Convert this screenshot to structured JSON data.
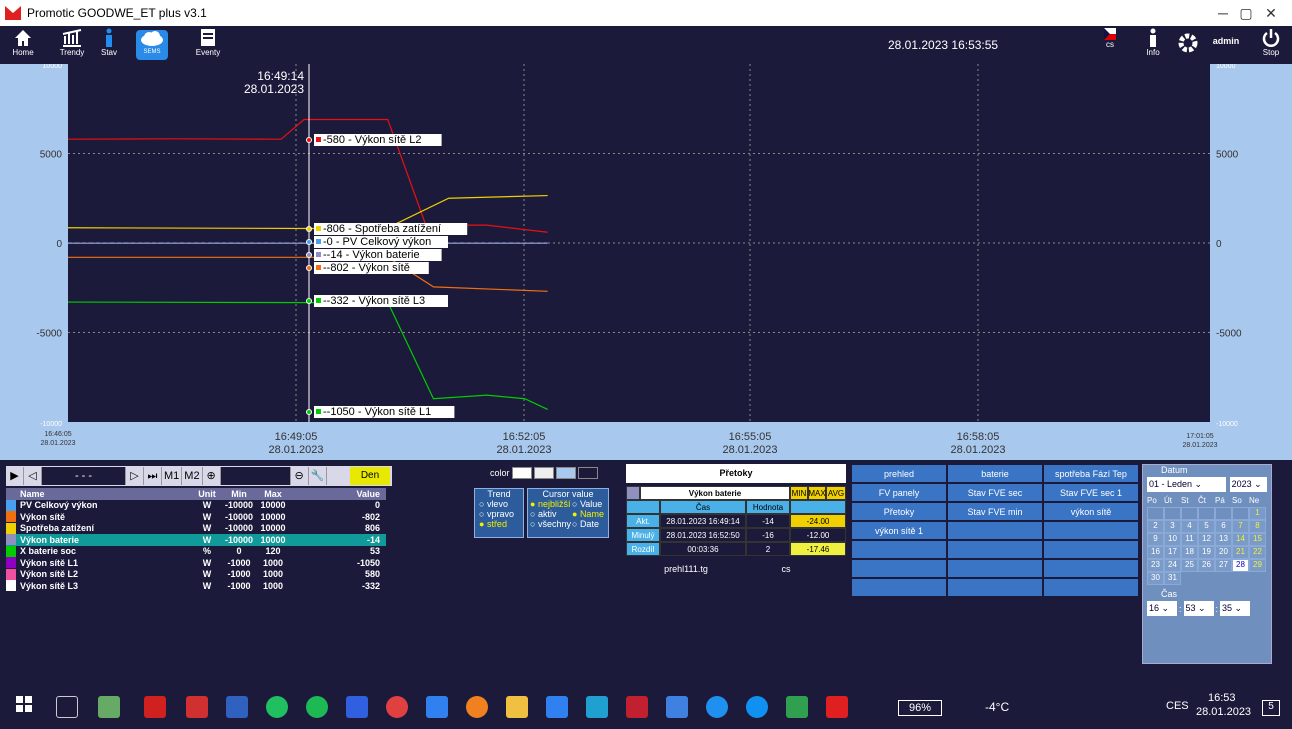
{
  "window": {
    "title": "Promotic GOODWE_ET plus  v3.1"
  },
  "toolbar": {
    "home": "Home",
    "trendy": "Trendy",
    "stav": "Stav",
    "sems": "SEMS",
    "eventy": "Eventy",
    "datetime": "28.01.2023 16:53:55",
    "lang": "cs",
    "info": "Info",
    "user": "admin",
    "stop": "Stop"
  },
  "chart": {
    "cursor_time": "16:49:14",
    "cursor_date": "28.01.2023",
    "left_ticks": [
      "10000",
      "5000",
      "0",
      "-5000",
      "-10000"
    ],
    "right_ticks": [
      "10000",
      "5000",
      "0",
      "-5000",
      "-10000"
    ],
    "x_start_time": "16:46:05",
    "x_start_date": "28.01.2023",
    "x_end_time": "17:01:05",
    "x_end_date": "28.01.2023",
    "x_ticks": [
      {
        "t": "16:49:05",
        "d": "28.01.2023"
      },
      {
        "t": "16:52:05",
        "d": "28.01.2023"
      },
      {
        "t": "16:55:05",
        "d": "28.01.2023"
      },
      {
        "t": "16:58:05",
        "d": "28.01.2023"
      }
    ],
    "labels": [
      "580 - Výkon sítě L2",
      "806 - Spotřeba zatížení",
      "0 - PV Celkový výkon",
      "-14 - Výkon baterie",
      "-802 - Výkon sítě",
      "-332 - Výkon sítě L3",
      "-1050 - Výkon sítě L1"
    ],
    "colors": {
      "L2": "#e81010",
      "spotreba": "#f0d000",
      "pv": "#4aa0f0",
      "baterie": "#9090c0",
      "sit": "#f07010",
      "L3": "#00cc00",
      "L1": "#00cc00"
    }
  },
  "chart_data": {
    "type": "line",
    "x": [
      "16:46:05",
      "16:49:05",
      "16:52:05",
      "16:55:05",
      "16:58:05",
      "17:01:05"
    ],
    "ylim": [
      -10000,
      10000
    ],
    "series": [
      {
        "name": "Výkon sítě L2",
        "values": [
          5800,
          5800,
          1100,
          600,
          null,
          null
        ]
      },
      {
        "name": "Spotřeba zatížení",
        "values": [
          850,
          810,
          2550,
          2650,
          null,
          null
        ]
      },
      {
        "name": "PV Celkový výkon",
        "values": [
          0,
          0,
          0,
          0,
          null,
          null
        ]
      },
      {
        "name": "Výkon baterie",
        "values": [
          -14,
          -14,
          -14,
          -14,
          null,
          null
        ]
      },
      {
        "name": "Výkon sítě",
        "values": [
          -800,
          -800,
          -2450,
          -2700,
          null,
          null
        ]
      },
      {
        "name": "Výkon sítě L3",
        "values": [
          -3300,
          -3330,
          -8700,
          -9300,
          null,
          null
        ]
      }
    ]
  },
  "controls": {
    "dots": "- - -",
    "m1": "M1",
    "m2": "M2",
    "den": "Den",
    "color": "color"
  },
  "table": {
    "headers": [
      "Name",
      "Unit",
      "Min",
      "Max",
      "Value"
    ],
    "rows": [
      {
        "name": "PV Celkový výkon",
        "unit": "W",
        "min": "-10000",
        "max": "10000",
        "value": "0",
        "color": "#4aa0f0"
      },
      {
        "name": "Výkon sítě",
        "unit": "W",
        "min": "-10000",
        "max": "10000",
        "value": "-802",
        "color": "#f07010"
      },
      {
        "name": "Spotřeba zatížení",
        "unit": "W",
        "min": "-10000",
        "max": "10000",
        "value": "806",
        "color": "#f0d000"
      },
      {
        "name": "Výkon baterie",
        "unit": "W",
        "min": "-10000",
        "max": "10000",
        "value": "-14",
        "color": "#9090c0"
      },
      {
        "name": "X  baterie soc",
        "unit": "%",
        "min": "0",
        "max": "120",
        "value": "53",
        "color": "#00cc00"
      },
      {
        "name": "Výkon sítě L1",
        "unit": "W",
        "min": "-1000",
        "max": "1000",
        "value": "-1050",
        "color": "#9000c0"
      },
      {
        "name": "Výkon sítě L2",
        "unit": "W",
        "min": "-1000",
        "max": "1000",
        "value": "580",
        "color": "#f050a0"
      },
      {
        "name": "Výkon sítě L3",
        "unit": "W",
        "min": "-1000",
        "max": "1000",
        "value": "-332",
        "color": "#ffffff"
      }
    ]
  },
  "trend": {
    "title": "Trend",
    "opts": [
      "vlevo",
      "vpravo",
      "střed"
    ]
  },
  "cursor_value": {
    "title": "Cursor value",
    "opts": [
      "nejbližší",
      "aktiv",
      "všechny"
    ],
    "opts2": [
      "Value",
      "Name",
      "Date"
    ]
  },
  "pretoky": "Přetoky",
  "vykon": {
    "title": "Výkon baterie",
    "min": "MIN",
    "max": "MAX",
    "avg": "AVG",
    "cas": "Čas",
    "hodnota": "Hodnota",
    "rows": [
      {
        "label": "Akt.",
        "cas": "28.01.2023 16:49:14",
        "hod": "-14",
        "v": "-24.00"
      },
      {
        "label": "Minulý",
        "cas": "28.01.2023 16:52:50",
        "hod": "-16",
        "v": "-12.00"
      },
      {
        "label": "Rozdíl",
        "cas": "00:03:36",
        "hod": "2",
        "v": "-17.46"
      }
    ],
    "file": "prehl111.tg",
    "lang": "cs"
  },
  "buttons": [
    "prehled",
    "baterie",
    "spotřeba Fází Tep",
    "FV panely",
    "Stav FVE sec",
    "Stav FVE sec 1",
    "Přetoky",
    "Stav FVE min",
    "výkon sítě",
    "výkon sítě 1",
    "",
    "",
    "",
    "",
    "",
    "",
    "",
    "",
    "",
    "",
    ""
  ],
  "datum": {
    "title": "Datum",
    "month": "01 - Leden",
    "year": "2023",
    "days_hdr": [
      "Po",
      "Út",
      "St",
      "Čt",
      "Pá",
      "So",
      "Ne"
    ],
    "days": [
      "",
      "",
      "",
      "",
      "",
      "",
      "1",
      "2",
      "3",
      "4",
      "5",
      "6",
      "7",
      "8",
      "9",
      "10",
      "11",
      "12",
      "13",
      "14",
      "15",
      "16",
      "17",
      "18",
      "19",
      "20",
      "21",
      "22",
      "23",
      "24",
      "25",
      "26",
      "27",
      "28",
      "29",
      "30",
      "31"
    ],
    "cas_title": "Čas",
    "h": "16",
    "m": "53",
    "s": "35"
  },
  "taskbar": {
    "battery": "96%",
    "temp": "-4°C",
    "lang": "CES",
    "time": "16:53",
    "date": "28.01.2023",
    "notif": "5"
  }
}
